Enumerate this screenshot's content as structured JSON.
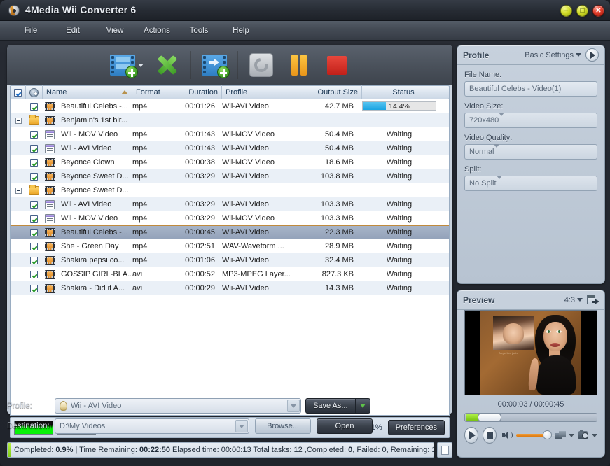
{
  "window": {
    "title": "4Media Wii Converter 6",
    "app_icon": "disc-icon",
    "minimize": "−",
    "maximize": "□",
    "close": "✕"
  },
  "menubar": {
    "items": [
      "File",
      "Edit",
      "View",
      "Actions",
      "Tools",
      "Help"
    ]
  },
  "toolbar": {
    "buttons": [
      {
        "name": "add-file-button",
        "icon": "film-add-icon",
        "has_dropdown": true
      },
      {
        "name": "remove-file-button",
        "icon": "green-x-icon",
        "has_dropdown": false
      },
      {
        "name": "add-clip-button",
        "icon": "film-arrow-add-icon",
        "has_dropdown": false
      },
      {
        "name": "convert-button",
        "icon": "refresh-icon",
        "has_dropdown": false
      },
      {
        "name": "pause-button",
        "icon": "pause-icon",
        "has_dropdown": false
      },
      {
        "name": "stop-button",
        "icon": "stop-icon",
        "has_dropdown": false
      }
    ]
  },
  "file_list": {
    "columns": [
      "",
      "",
      "Name",
      "Format",
      "Duration",
      "Profile",
      "Output Size",
      "Status"
    ],
    "sort_column": "Name",
    "rows": [
      {
        "type": "file",
        "indent": 1,
        "checked": true,
        "icon": "film-icon",
        "name": "Beautiful Celebs -...",
        "format": "mp4",
        "duration": "00:01:26",
        "profile": "Wii-AVI Video",
        "size": "42.7 MB",
        "status": "14.4%",
        "progress": 14.4
      },
      {
        "type": "folder",
        "indent": 0,
        "checked": false,
        "icon": "folder-icon",
        "name": "Benjamin's 1st bir...",
        "format": "",
        "duration": "",
        "profile": "",
        "size": "",
        "status": "",
        "progress": null
      },
      {
        "type": "child",
        "indent": 2,
        "checked": true,
        "icon": "list-icon",
        "name": "Wii - MOV Video",
        "format": "mp4",
        "duration": "00:01:43",
        "profile": "Wii-MOV Video",
        "size": "50.4 MB",
        "status": "Waiting",
        "progress": null
      },
      {
        "type": "child",
        "indent": 2,
        "checked": true,
        "icon": "list-icon",
        "name": "Wii - AVI Video",
        "format": "mp4",
        "duration": "00:01:43",
        "profile": "Wii-AVI Video",
        "size": "50.4 MB",
        "status": "Waiting",
        "progress": null
      },
      {
        "type": "file",
        "indent": 1,
        "checked": true,
        "icon": "film-icon",
        "name": "Beyonce Clown",
        "format": "mp4",
        "duration": "00:00:38",
        "profile": "Wii-MOV Video",
        "size": "18.6 MB",
        "status": "Waiting",
        "progress": null
      },
      {
        "type": "file",
        "indent": 1,
        "checked": true,
        "icon": "film-icon",
        "name": "Beyonce Sweet D...",
        "format": "mp4",
        "duration": "00:03:29",
        "profile": "Wii-AVI Video",
        "size": "103.8 MB",
        "status": "Waiting",
        "progress": null
      },
      {
        "type": "folder",
        "indent": 0,
        "checked": false,
        "icon": "folder-icon",
        "name": "Beyonce Sweet D...",
        "format": "",
        "duration": "",
        "profile": "",
        "size": "",
        "status": "",
        "progress": null
      },
      {
        "type": "child",
        "indent": 2,
        "checked": true,
        "icon": "list-icon",
        "name": "Wii - AVI Video",
        "format": "mp4",
        "duration": "00:03:29",
        "profile": "Wii-AVI Video",
        "size": "103.3 MB",
        "status": "Waiting",
        "progress": null
      },
      {
        "type": "child",
        "indent": 2,
        "checked": true,
        "icon": "list-icon",
        "name": "Wii - MOV Video",
        "format": "mp4",
        "duration": "00:03:29",
        "profile": "Wii-MOV Video",
        "size": "103.3 MB",
        "status": "Waiting",
        "progress": null
      },
      {
        "type": "file",
        "indent": 1,
        "checked": true,
        "icon": "film-icon",
        "name": "Beautiful Celebs -...",
        "format": "mp4",
        "duration": "00:00:45",
        "profile": "Wii-AVI Video",
        "size": "22.3 MB",
        "status": "Waiting",
        "progress": null,
        "selected": true
      },
      {
        "type": "file",
        "indent": 1,
        "checked": true,
        "icon": "film-icon",
        "name": "She - Green Day",
        "format": "mp4",
        "duration": "00:02:51",
        "profile": "WAV-Waveform ...",
        "size": "28.9 MB",
        "status": "Waiting",
        "progress": null
      },
      {
        "type": "file",
        "indent": 1,
        "checked": true,
        "icon": "film-icon",
        "name": "Shakira pepsi co...",
        "format": "mp4",
        "duration": "00:01:06",
        "profile": "Wii-AVI Video",
        "size": "32.4 MB",
        "status": "Waiting",
        "progress": null
      },
      {
        "type": "file",
        "indent": 1,
        "checked": true,
        "icon": "film-icon",
        "name": "GOSSIP GIRL-BLA...",
        "format": "avi",
        "duration": "00:00:52",
        "profile": "MP3-MPEG Layer...",
        "size": "827.3 KB",
        "status": "Waiting",
        "progress": null
      },
      {
        "type": "file",
        "indent": 1,
        "checked": true,
        "icon": "film-icon",
        "name": "Shakira - Did it A...",
        "format": "avi",
        "duration": "00:00:29",
        "profile": "Wii-AVI Video",
        "size": "14.3 MB",
        "status": "Waiting",
        "progress": null
      }
    ]
  },
  "cpu_bar": {
    "cpu_label": "CPU:70.31%",
    "preferences_label": "Preferences"
  },
  "bottom_form": {
    "profile_label": "Profile:",
    "profile_value": "Wii - AVI Video",
    "destination_label": "Destination:",
    "destination_value": "D:\\My Videos",
    "save_as_label": "Save As...",
    "browse_label": "Browse...",
    "open_label": "Open"
  },
  "status_bar": {
    "text_parts": [
      {
        "t": "Completed: ",
        "b": false
      },
      {
        "t": "0.9%",
        "b": true
      },
      {
        "t": " | Time Remaining: ",
        "b": false
      },
      {
        "t": "00:22:50",
        "b": true
      },
      {
        "t": " Elapsed time: 00:00:13 Total tasks: 12 ,Completed: ",
        "b": false
      },
      {
        "t": "0",
        "b": true
      },
      {
        "t": ", Failed: 0, Remaining: 1",
        "b": false
      }
    ],
    "full_text": "Completed: 0.9% | Time Remaining: 00:22:50 Elapsed time: 00:00:13 Total tasks: 12 ,Completed: 0, Failed: 0, Remaining: 1",
    "log_button": "log-icon"
  },
  "profile_panel": {
    "title": "Profile",
    "settings_mode": "Basic Settings",
    "fields": [
      {
        "label": "File Name:",
        "value": "Beautiful Celebs - Video(1)",
        "type": "text"
      },
      {
        "label": "Video Size:",
        "value": "720x480",
        "type": "select"
      },
      {
        "label": "Video Quality:",
        "value": "Normal",
        "type": "select"
      },
      {
        "label": "Split:",
        "value": "No Split",
        "type": "select"
      }
    ]
  },
  "preview_panel": {
    "title": "Preview",
    "aspect_ratio": "4:3",
    "time_display": "00:00:03 / 00:00:45",
    "current_time": "00:00:03",
    "total_time": "00:00:45",
    "progress_percent": 6,
    "volume_percent": 63,
    "watermark_text": "Angelina jolie",
    "controls": [
      "play-button",
      "stop-button",
      "volume-icon",
      "volume-slider",
      "snapshot-series-button",
      "snapshot-button"
    ]
  },
  "colors": {
    "accent_blue": "#1ba4e2",
    "green": "#4fae31",
    "orange": "#e8951a",
    "red": "#c22019",
    "titlebar": "#262b33",
    "panel": "#c7d1dd"
  }
}
